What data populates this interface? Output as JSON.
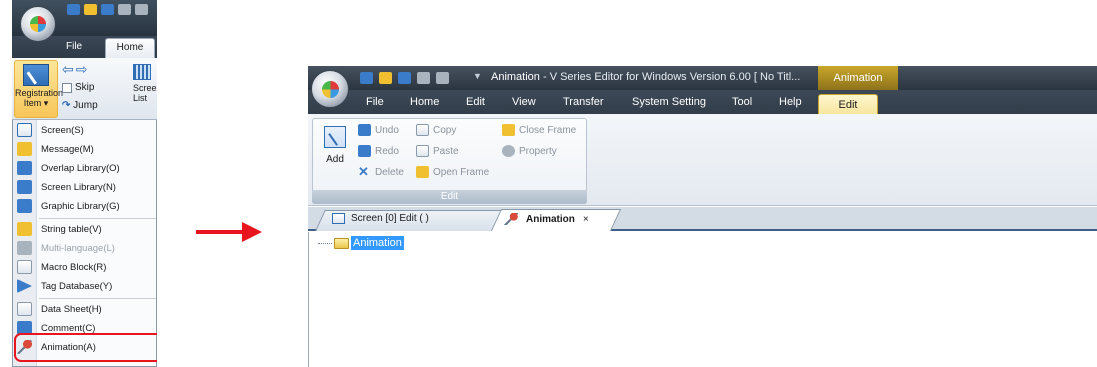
{
  "left_panel": {
    "tabs": {
      "file": "File",
      "home": "Home"
    },
    "ribbon": {
      "registration_item": "Registration Item ▾",
      "skip": "Skip",
      "jump": "Jump",
      "screen_list": "Scree List"
    },
    "menu_items": [
      {
        "label": "Screen(S)",
        "icon": "screen-icon",
        "enabled": true
      },
      {
        "label": "Message(M)",
        "icon": "message-icon",
        "enabled": true
      },
      {
        "label": "Overlap Library(O)",
        "icon": "overlap-library-icon",
        "enabled": true
      },
      {
        "label": "Screen Library(N)",
        "icon": "screen-library-icon",
        "enabled": true
      },
      {
        "label": "Graphic Library(G)",
        "icon": "graphic-library-icon",
        "enabled": true
      },
      {
        "label": "String table(V)",
        "icon": "string-table-icon",
        "enabled": true
      },
      {
        "label": "Multi-language(L)",
        "icon": "multi-language-icon",
        "enabled": false
      },
      {
        "label": "Macro Block(R)",
        "icon": "macro-block-icon",
        "enabled": true
      },
      {
        "label": "Tag Database(Y)",
        "icon": "tag-database-icon",
        "enabled": true
      },
      {
        "label": "Data Sheet(H)",
        "icon": "data-sheet-icon",
        "enabled": true
      },
      {
        "label": "Comment(C)",
        "icon": "comment-icon",
        "enabled": true
      },
      {
        "label": "Animation(A)",
        "icon": "animation-icon",
        "enabled": true
      }
    ],
    "highlighted_item": "Animation(A)",
    "highlight_color": "#e8141e"
  },
  "arrow_color": "#e8141e",
  "window": {
    "title_prefix": "Animation",
    "title_app": " - V Series Editor for Windows Version 6.00 [ No Titl...",
    "context_tab_group": "Animation",
    "menu_tabs": [
      "File",
      "Home",
      "Edit",
      "View",
      "Transfer",
      "System Setting",
      "Tool",
      "Help"
    ],
    "active_context_tab": "Edit",
    "ribbon": {
      "add": "Add",
      "undo": "Undo",
      "redo": "Redo",
      "delete": "Delete",
      "copy": "Copy",
      "paste": "Paste",
      "open_frame": "Open Frame",
      "close_frame": "Close Frame",
      "property": "Property",
      "group_caption": "Edit"
    },
    "doc_tabs": {
      "screen_tab": "Screen [0] Edit (         )",
      "animation_tab": "Animation",
      "close_glyph": "×"
    },
    "tree_root": "Animation"
  }
}
